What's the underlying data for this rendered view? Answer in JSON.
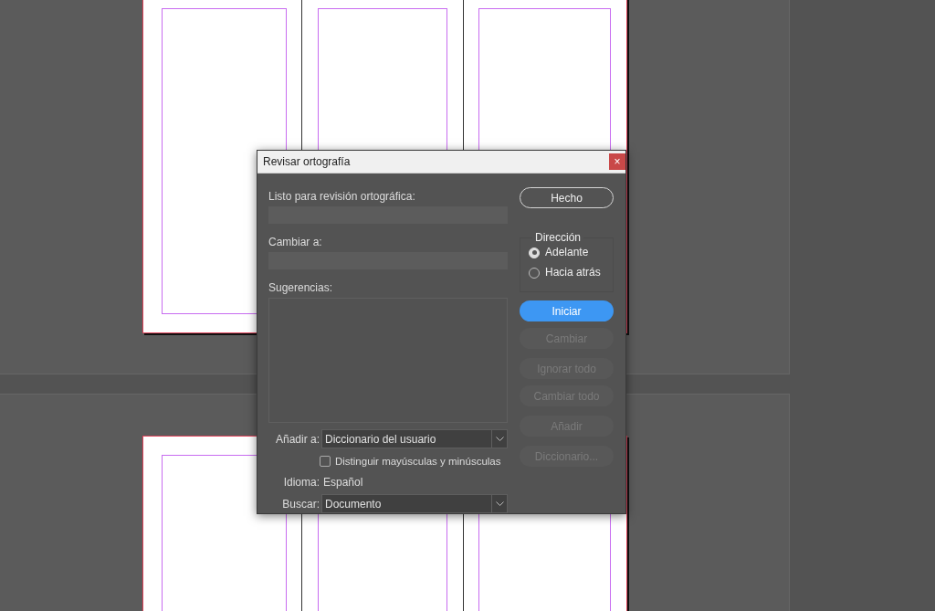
{
  "dialog": {
    "title": "Revisar ortografía",
    "close": "×",
    "fields": [
      {
        "label": "Listo para revisión ortográfica:"
      },
      {
        "label": "Cambiar a:"
      }
    ],
    "suggestions": {
      "label": "Sugerencias:"
    },
    "add_to": {
      "label": "Añadir a:",
      "value": "Diccionario del usuario"
    },
    "case_sensitive": {
      "label": "Distinguir mayúsculas y minúsculas",
      "checked": false
    },
    "language": {
      "label": "Idioma:",
      "value": "Español"
    },
    "search": {
      "label": "Buscar:",
      "value": "Documento"
    },
    "direction": {
      "label": "Dirección",
      "options": [
        {
          "label": "Adelante",
          "selected": true
        },
        {
          "label": "Hacia atrás",
          "selected": false
        }
      ]
    },
    "top_button": {
      "label": "Hecho",
      "kind": "outline"
    },
    "buttons": [
      {
        "label": "Iniciar",
        "kind": "primary",
        "disabled": false
      },
      {
        "label": "Cambiar",
        "kind": "plain",
        "disabled": true
      },
      {
        "label": "Ignorar todo",
        "kind": "plain",
        "disabled": true
      },
      {
        "label": "Cambiar todo",
        "kind": "plain",
        "disabled": true
      },
      {
        "label": "Añadir",
        "kind": "plain",
        "disabled": true
      },
      {
        "label": "Diccionario...",
        "kind": "plain",
        "disabled": true
      }
    ]
  }
}
